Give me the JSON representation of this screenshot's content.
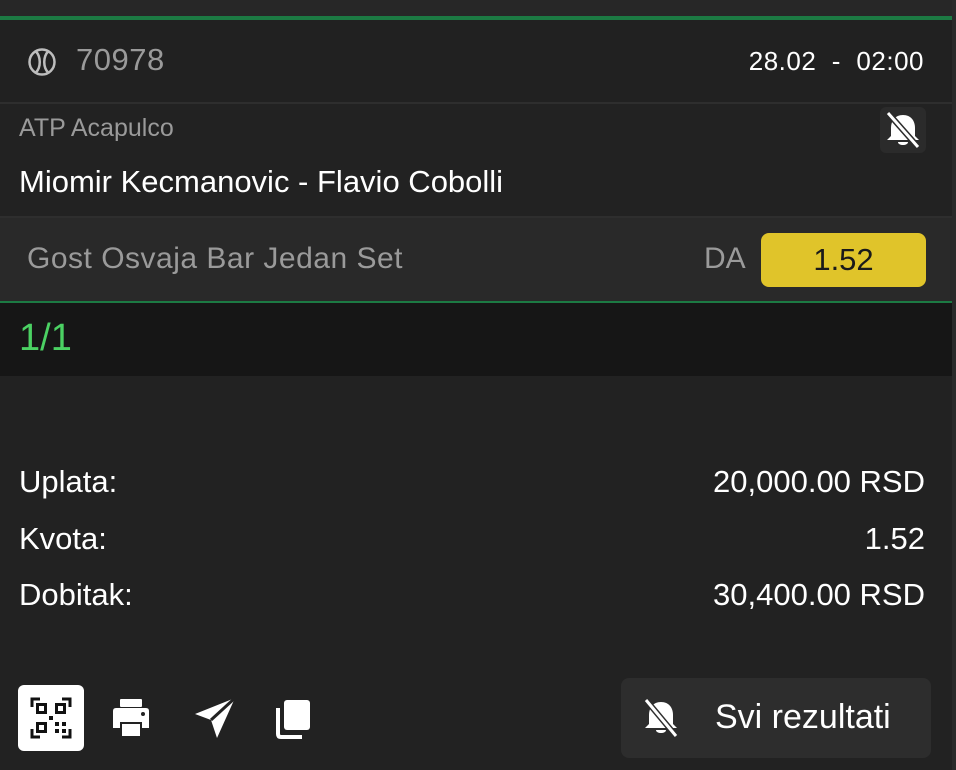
{
  "ticket": {
    "event_id": "70978",
    "date": "28.02",
    "separator": "-",
    "time": "02:00",
    "sport_icon": "tennis-ball-icon"
  },
  "match": {
    "league": "ATP Acapulco",
    "name": "Miomir Kecmanovic - Flavio Cobolli",
    "notification_icon": "bell-off-icon"
  },
  "pick": {
    "market": "Gost Osvaja Bar Jedan Set",
    "outcome": "DA",
    "odd": "1.52"
  },
  "count": "1/1",
  "summary": {
    "stake_label": "Uplata:",
    "stake_value": "20,000.00 RSD",
    "odds_label": "Kvota:",
    "odds_value": "1.52",
    "win_label": "Dobitak:",
    "win_value": "30,400.00 RSD"
  },
  "actions": {
    "qr_icon": "qr-code-icon",
    "print_icon": "printer-icon",
    "share_icon": "send-icon",
    "copy_icon": "copy-icon",
    "results_label": "Svi rezultati",
    "results_icon": "bell-off-icon"
  },
  "colors": {
    "background": "#222222",
    "accent_green": "#1c7a43",
    "count_green": "#4bd163",
    "odd_yellow": "#e0c42a"
  }
}
